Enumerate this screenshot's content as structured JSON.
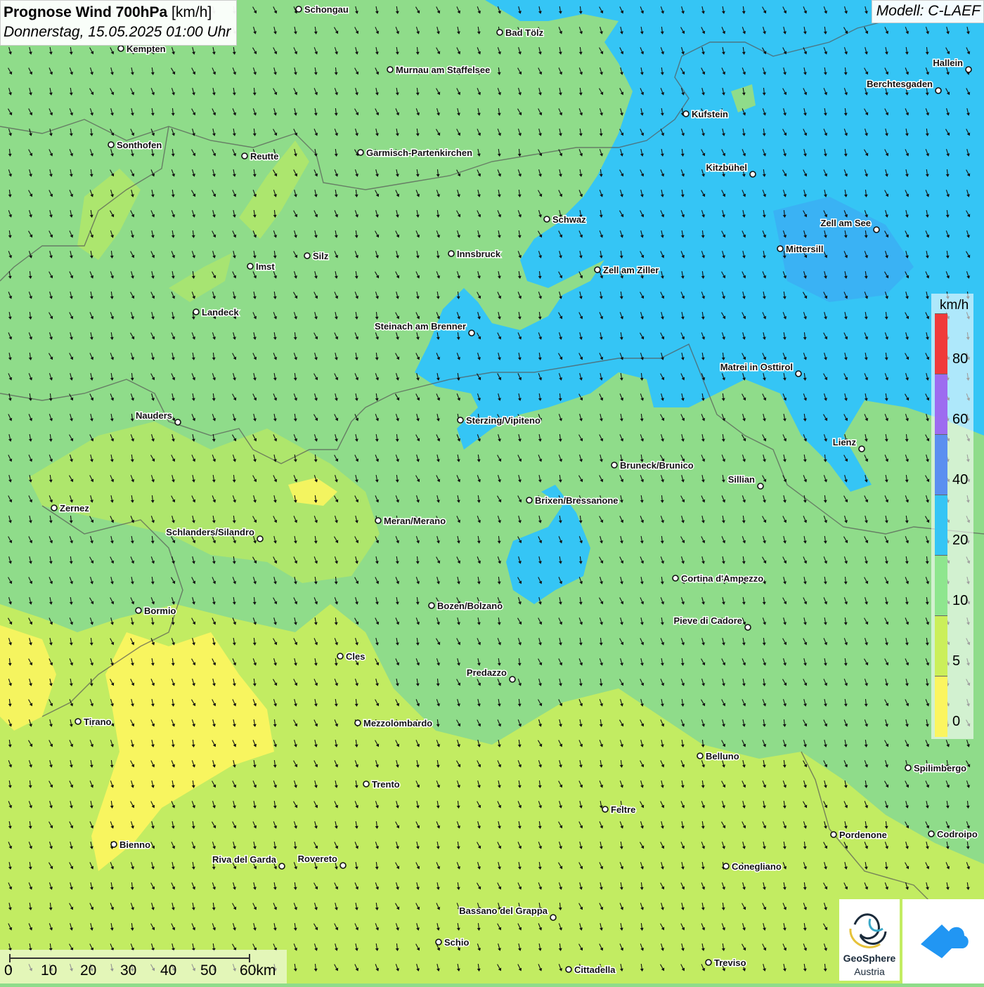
{
  "title": {
    "main": "Prognose Wind 700hPa",
    "unit": "[km/h]",
    "datetime": "Donnerstag, 15.05.2025 01:00 Uhr"
  },
  "model": "Modell: C-LAEF",
  "legend": {
    "unit": "km/h",
    "labels": [
      "80",
      "60",
      "40",
      "20",
      "10",
      "5",
      "0"
    ],
    "colors": [
      "#f03a3a",
      "#9d6cf0",
      "#5b8ff0",
      "#35c5f5",
      "#8ee68e",
      "#cbef5a",
      "#fbf55f"
    ]
  },
  "colors": {
    "calm": "#fbf55f",
    "light": "#cbef5a",
    "moderate": "#8ee68e",
    "fresh": "#35c5f5",
    "strong": "#5b8ff0"
  },
  "scalebar": {
    "labels": [
      "0",
      "10",
      "20",
      "30",
      "40",
      "50",
      "60km"
    ]
  },
  "logos": {
    "geosphere_line1": "GeoSphere",
    "geosphere_line2": "Austria"
  },
  "cities": [
    {
      "name": "Schongau"
    },
    {
      "name": "Bad Tölz"
    },
    {
      "name": "Kempten"
    },
    {
      "name": "Murnau am Staffelsee"
    },
    {
      "name": "Hallein"
    },
    {
      "name": "Berchtesgaden"
    },
    {
      "name": "Kufstein"
    },
    {
      "name": "Sonthofen"
    },
    {
      "name": "Reutte"
    },
    {
      "name": "Garmisch-Partenkirchen"
    },
    {
      "name": "Kitzbühel"
    },
    {
      "name": "Schwaz"
    },
    {
      "name": "Zell am See"
    },
    {
      "name": "Innsbruck"
    },
    {
      "name": "Mittersill"
    },
    {
      "name": "Silz"
    },
    {
      "name": "Imst"
    },
    {
      "name": "Zell am Ziller"
    },
    {
      "name": "Landeck"
    },
    {
      "name": "Steinach am Brenner"
    },
    {
      "name": "Matrei in Osttirol"
    },
    {
      "name": "Nauders"
    },
    {
      "name": "Sterzing/Vipiteno"
    },
    {
      "name": "Lienz"
    },
    {
      "name": "Bruneck/Brunico"
    },
    {
      "name": "Sillian"
    },
    {
      "name": "Zernez"
    },
    {
      "name": "Brixen/Bressanone"
    },
    {
      "name": "Meran/Merano"
    },
    {
      "name": "Schlanders/Silandro"
    },
    {
      "name": "Cortina d'Ampezzo"
    },
    {
      "name": "Bozen/Bolzano"
    },
    {
      "name": "Bormio"
    },
    {
      "name": "Pieve di Cadore"
    },
    {
      "name": "Cles"
    },
    {
      "name": "Predazzo"
    },
    {
      "name": "Tirano"
    },
    {
      "name": "Mezzolombardo"
    },
    {
      "name": "Belluno"
    },
    {
      "name": "Spilimbergo"
    },
    {
      "name": "Trento"
    },
    {
      "name": "Feltre"
    },
    {
      "name": "Pordenone"
    },
    {
      "name": "Codroipo"
    },
    {
      "name": "Bienno"
    },
    {
      "name": "Riva del Garda"
    },
    {
      "name": "Rovereto"
    },
    {
      "name": "Conegliano"
    },
    {
      "name": "Bassano del Grappa"
    },
    {
      "name": "Schio"
    },
    {
      "name": "Treviso"
    },
    {
      "name": "Cittadella"
    }
  ]
}
